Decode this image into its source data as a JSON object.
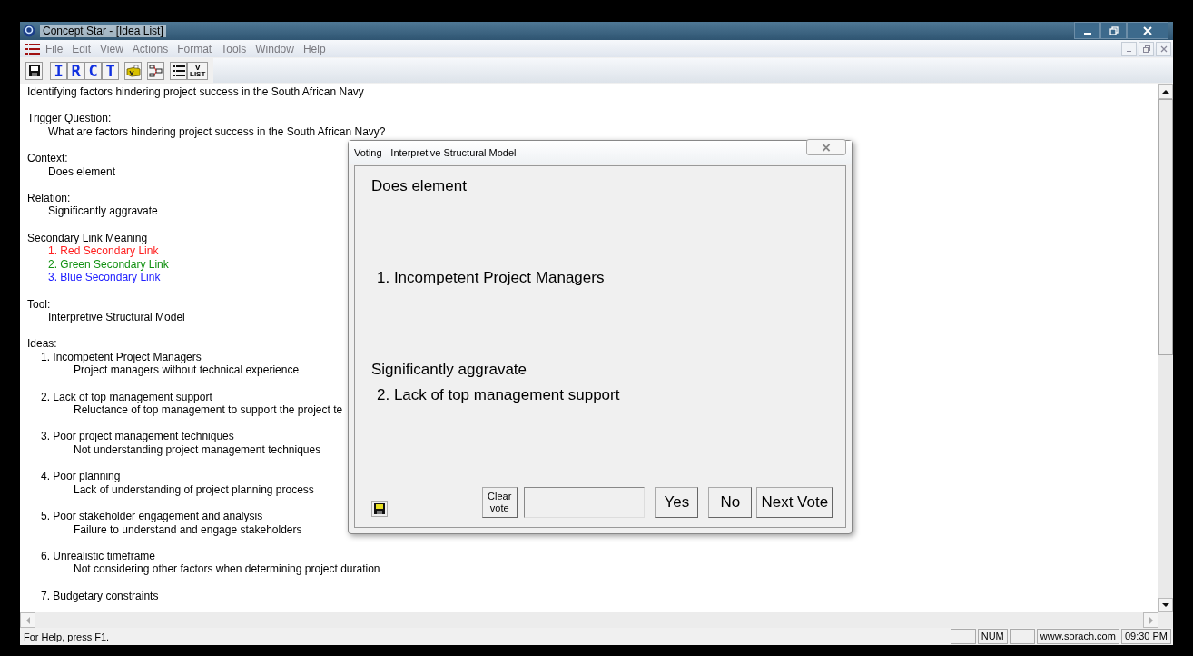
{
  "window": {
    "title": "Concept Star - [Idea List]"
  },
  "menu": [
    "File",
    "Edit",
    "View",
    "Actions",
    "Format",
    "Tools",
    "Window",
    "Help"
  ],
  "toolbar": [
    {
      "kind": "save"
    },
    {
      "kind": "letter",
      "label": "I"
    },
    {
      "kind": "letter",
      "label": "R"
    },
    {
      "kind": "letter",
      "label": "C"
    },
    {
      "kind": "letter",
      "label": "T"
    },
    {
      "kind": "vote"
    },
    {
      "kind": "tree"
    },
    {
      "kind": "list"
    },
    {
      "kind": "vlist",
      "label": "V",
      "sublabel": "LIST"
    }
  ],
  "document": {
    "heading": "Identifying factors hindering project success in the South African Navy",
    "sections": [
      {
        "label": "Trigger Question:",
        "lines": [
          {
            "text": "What are factors hindering project success in the South African Navy?"
          }
        ]
      },
      {
        "label": "Context:",
        "lines": [
          {
            "text": "Does element"
          }
        ]
      },
      {
        "label": "Relation:",
        "lines": [
          {
            "text": "Significantly aggravate"
          }
        ]
      },
      {
        "label": "Secondary Link Meaning",
        "lines": [
          {
            "text": "1. Red Secondary Link",
            "color": "#ff2020"
          },
          {
            "text": "2. Green Secondary Link",
            "color": "#109010"
          },
          {
            "text": "3. Blue Secondary Link",
            "color": "#2020ff"
          }
        ]
      },
      {
        "label": "Tool:",
        "lines": [
          {
            "text": "Interpretive Structural Model"
          }
        ]
      }
    ],
    "ideas_label": "Ideas:",
    "ideas": [
      {
        "title": "1. Incompetent Project Managers",
        "description": "Project managers without technical experience"
      },
      {
        "title": "2. Lack of top management support",
        "description": "Reluctance of top management to support the project te"
      },
      {
        "title": "3. Poor project management techniques",
        "description": "Not understanding project management techniques"
      },
      {
        "title": "4. Poor planning",
        "description": "Lack of understanding of project planning process"
      },
      {
        "title": "5. Poor stakeholder engagement and analysis",
        "description": "Failure to understand and engage stakeholders"
      },
      {
        "title": "6. Unrealistic timeframe",
        "description": "Not considering other factors when determining project duration"
      },
      {
        "title": "7. Budgetary constraints"
      }
    ]
  },
  "dialog": {
    "title": "Voting - Interpretive Structural Model",
    "context": "Does element",
    "element_a": "1. Incompetent Project Managers",
    "relation": "Significantly aggravate",
    "element_b": "2. Lack of top management support",
    "clear_button": "Clear vote",
    "buttons": [
      "Yes",
      "No",
      "Next Vote"
    ]
  },
  "status_bar": {
    "message": "For Help, press F1.",
    "panes": [
      "NUM",
      "www.sorach.com",
      "09:30 PM"
    ]
  }
}
